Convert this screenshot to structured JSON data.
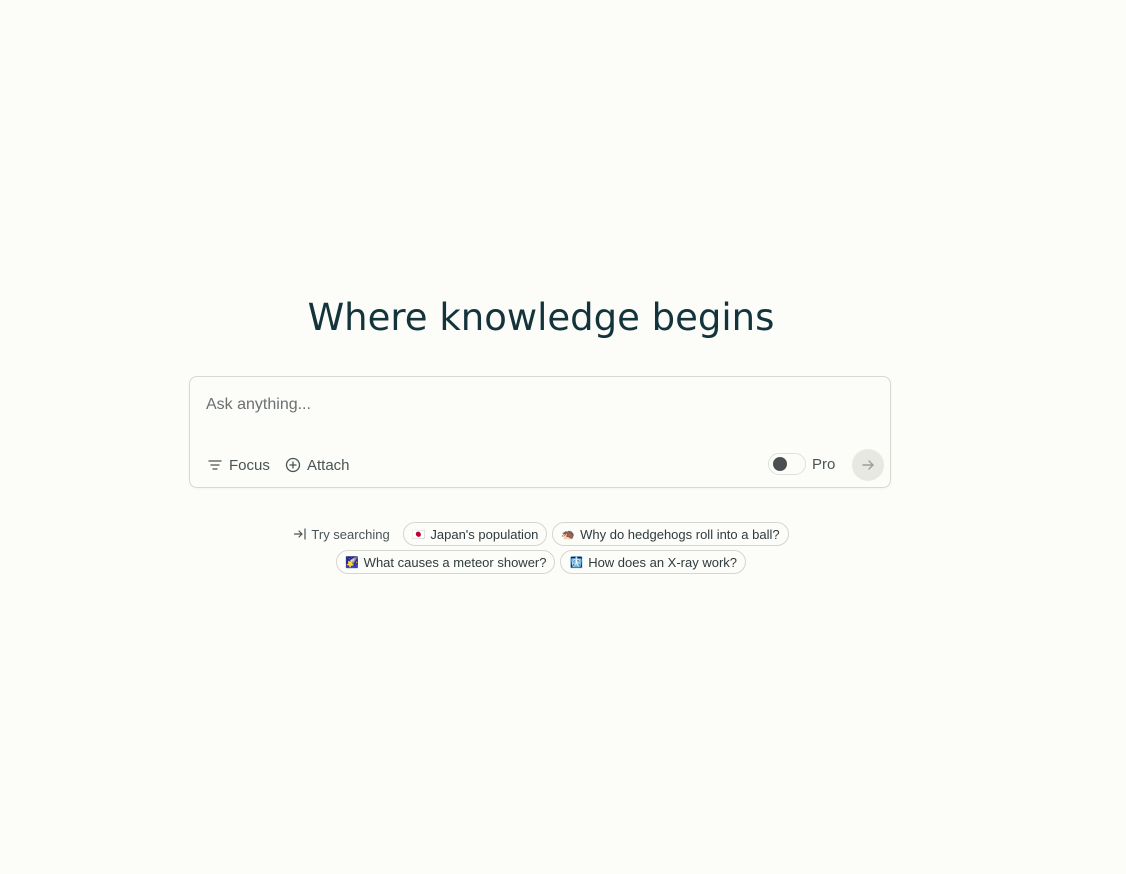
{
  "hero": {
    "title": "Where knowledge begins"
  },
  "search": {
    "placeholder": "Ask anything...",
    "focus_label": "Focus",
    "attach_label": "Attach",
    "pro_label": "Pro",
    "pro_enabled": false
  },
  "icons": {
    "focus": "filter-lines-icon",
    "attach": "plus-circle-icon",
    "submit": "arrow-right-icon",
    "try": "arrow-into-icon"
  },
  "suggestions": {
    "label": "Try searching",
    "rows": [
      [
        {
          "emoji": "🇯🇵",
          "text": "Japan's population"
        },
        {
          "emoji": "🦔",
          "text": "Why do hedgehogs roll into a ball?"
        }
      ],
      [
        {
          "emoji": "🌠",
          "text": "What causes a meteor shower?"
        },
        {
          "emoji": "🩻",
          "text": "How does an X-ray work?"
        }
      ]
    ]
  },
  "colors": {
    "background": "#fcfcf9",
    "title_text": "#13343b",
    "border": "#d8d8d2"
  }
}
